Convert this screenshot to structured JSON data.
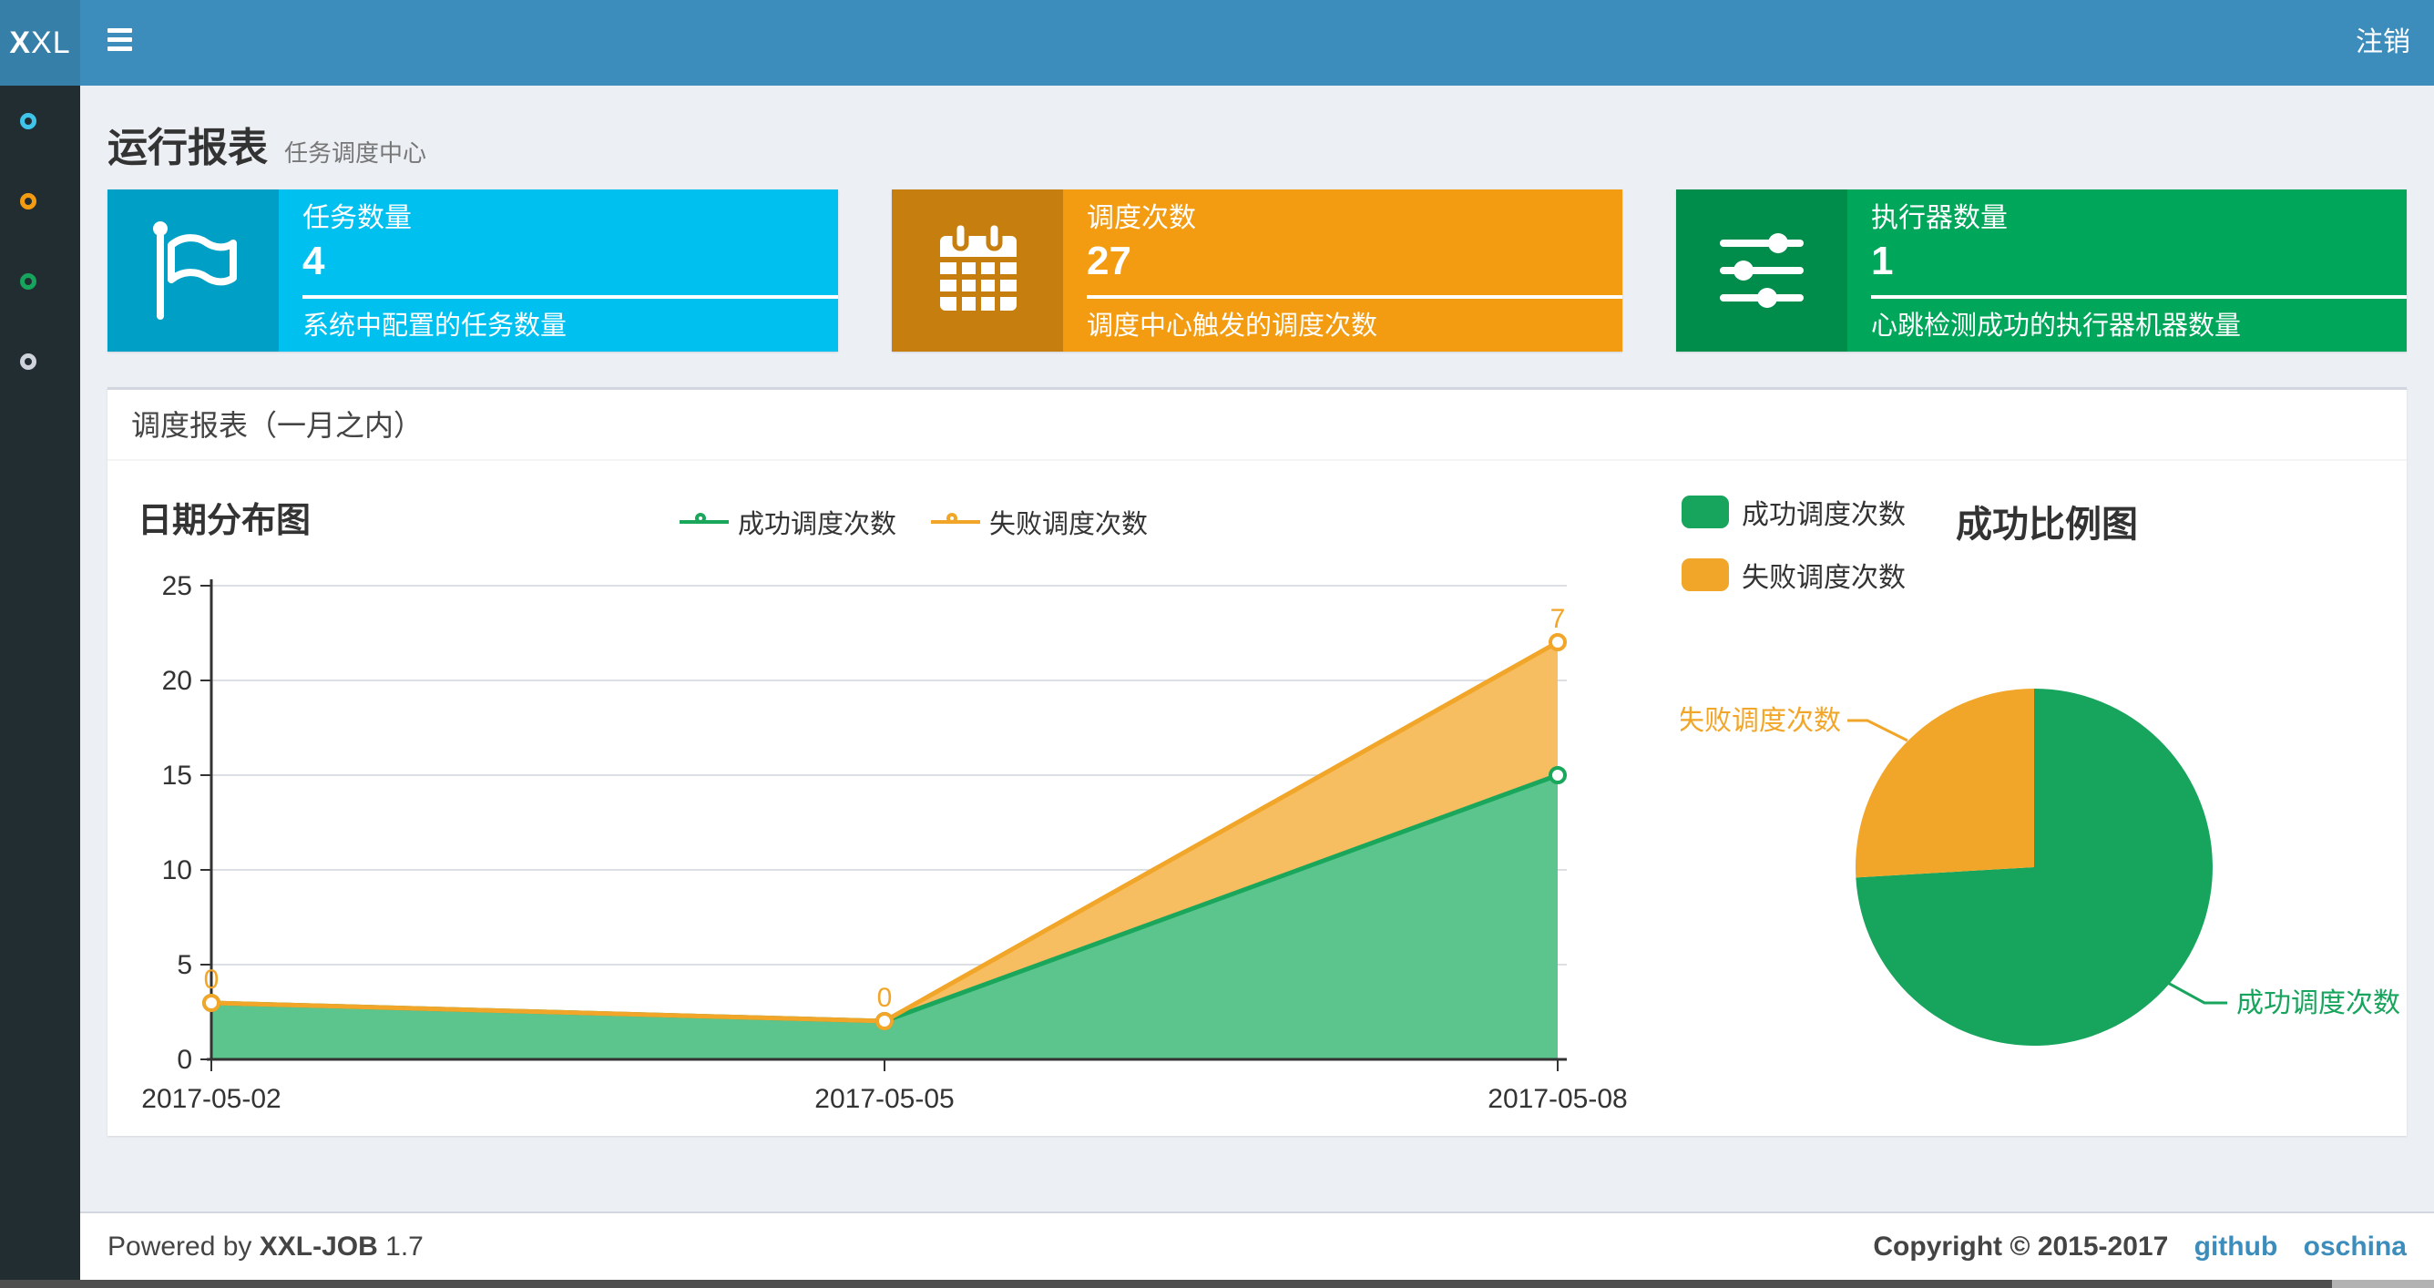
{
  "header": {
    "logo_bold": "X",
    "logo_rest": "XL",
    "logout": "注销"
  },
  "sidebar": {
    "items": [
      {
        "icon": "circle-outline-icon",
        "color": "#3fc4ea"
      },
      {
        "icon": "circle-outline-icon",
        "color": "#f39c12"
      },
      {
        "icon": "circle-outline-icon",
        "color": "#17a45c"
      },
      {
        "icon": "circle-outline-icon",
        "color": "#cfd4dc"
      }
    ]
  },
  "page": {
    "title": "运行报表",
    "subtitle": "任务调度中心"
  },
  "info_boxes": [
    {
      "icon": "flag-icon",
      "label": "任务数量",
      "value": "4",
      "desc": "系统中配置的任务数量",
      "color": "#00c0ef"
    },
    {
      "icon": "calendar-icon",
      "label": "调度次数",
      "value": "27",
      "desc": "调度中心触发的调度次数",
      "color": "#f39c12"
    },
    {
      "icon": "sliders-icon",
      "label": "执行器数量",
      "value": "1",
      "desc": "心跳检测成功的执行器机器数量",
      "color": "#00a65a"
    }
  ],
  "panel": {
    "title": "调度报表（一月之内）"
  },
  "chart_data": [
    {
      "type": "area",
      "title": "日期分布图",
      "stacked": true,
      "x": [
        "2017-05-02",
        "2017-05-05",
        "2017-05-08"
      ],
      "series": [
        {
          "name": "成功调度次数",
          "values": [
            3,
            2,
            15
          ],
          "line_color": "#1aa75c",
          "fill_color": "#5cc48d"
        },
        {
          "name": "失败调度次数",
          "values": [
            0,
            0,
            7
          ],
          "line_color": "#f2a629",
          "fill_color": "#f6bd61"
        }
      ],
      "point_labels": {
        "fail": [
          "0",
          "0",
          "7"
        ]
      },
      "ylabel": "",
      "xlabel": "",
      "ylim": [
        0,
        25
      ],
      "yticks": [
        "0",
        "5",
        "10",
        "15",
        "20",
        "25"
      ],
      "grid": true,
      "legend_position": "top"
    },
    {
      "type": "pie",
      "title": "成功比例图",
      "slices": [
        {
          "name": "成功调度次数",
          "value": 20,
          "color": "#17a45c"
        },
        {
          "name": "失败调度次数",
          "value": 7,
          "color": "#f2a629"
        }
      ],
      "legend_position": "left-top"
    }
  ],
  "footer": {
    "powered_prefix": "Powered by",
    "product": "XXL-JOB",
    "version": "1.7",
    "copyright": "Copyright © 2015-2017",
    "links": [
      "github",
      "oschina"
    ]
  }
}
